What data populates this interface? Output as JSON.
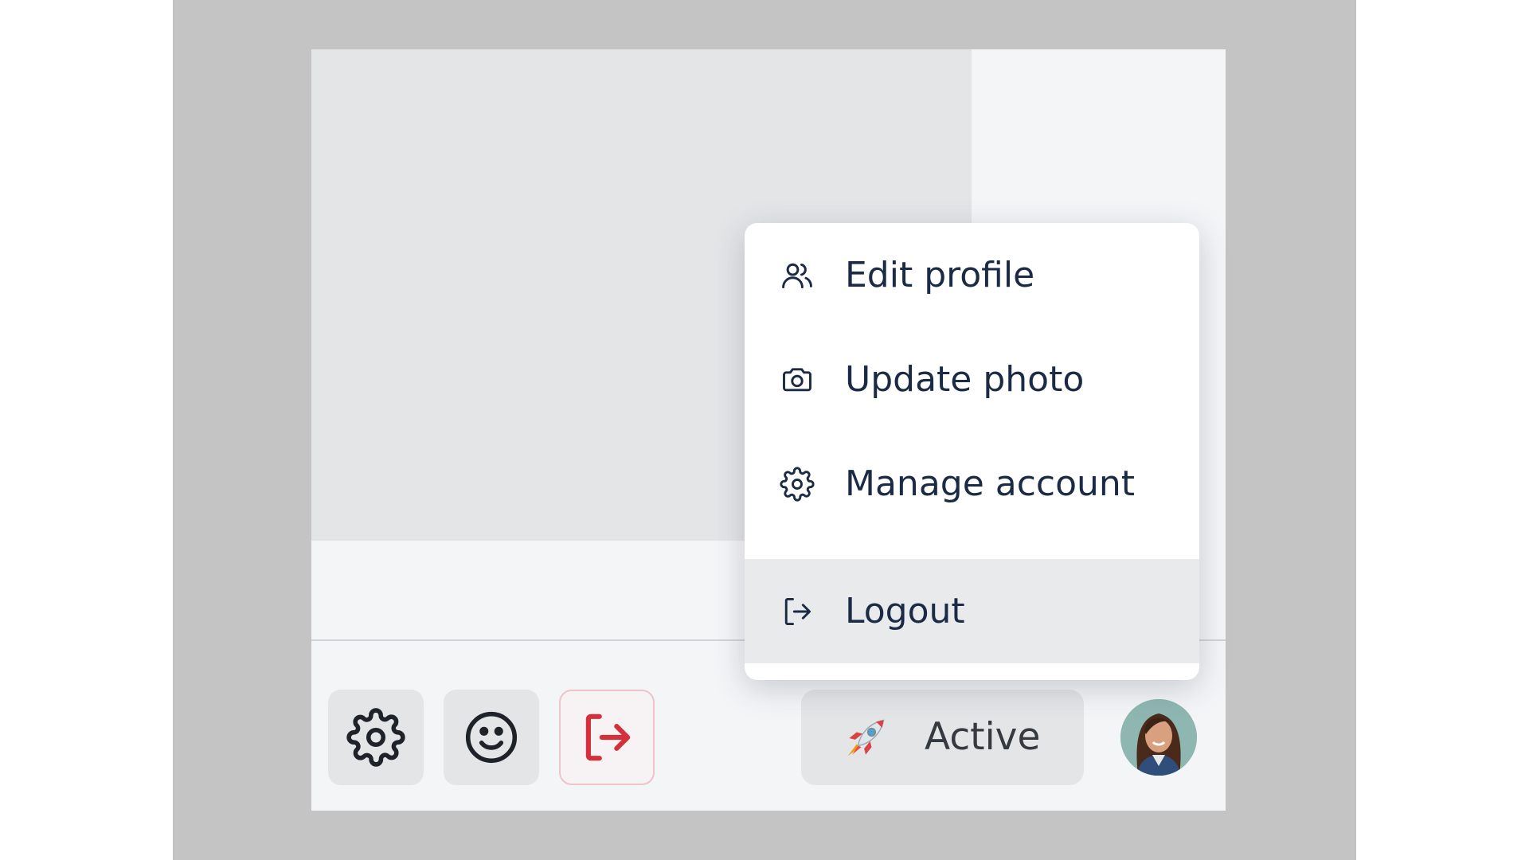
{
  "menu": {
    "items": [
      {
        "label": "Edit profile",
        "icon": "users-icon"
      },
      {
        "label": "Update photo",
        "icon": "camera-icon"
      },
      {
        "label": "Manage account",
        "icon": "gear-icon"
      },
      {
        "label": "Logout",
        "icon": "logout-icon",
        "highlighted": true
      }
    ]
  },
  "toolbar": {
    "settings_icon": "gear-icon",
    "emoji_icon": "smiley-icon",
    "logout_icon": "logout-icon",
    "logout_color": "#d3303c"
  },
  "status": {
    "emoji": "rocket",
    "label": "Active"
  },
  "colors": {
    "text": "#1b2b45",
    "highlight": "#e9eaec",
    "danger": "#d3303c"
  }
}
